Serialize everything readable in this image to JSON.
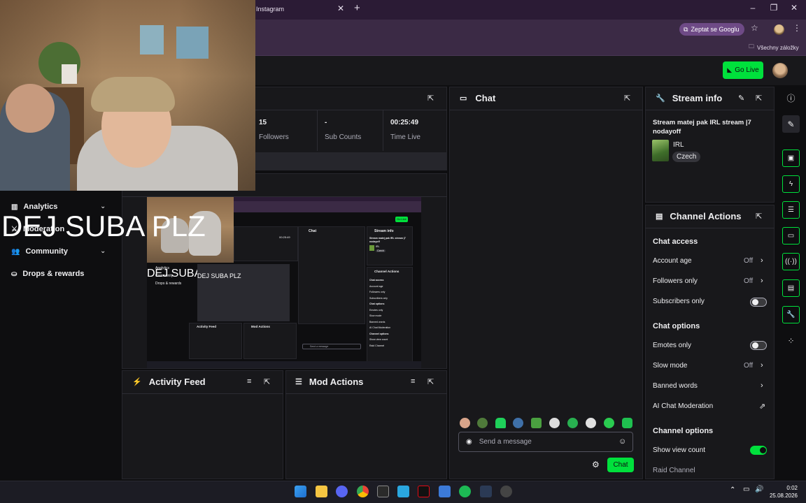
{
  "browser": {
    "tab_title": "Instagram",
    "tab_close": "✕",
    "tab_new": "+",
    "window_min": "–",
    "window_max": "❐",
    "window_close": "✕",
    "google_button": "Zeptat se Googlu",
    "bookmarks_label": "Všechny záložky"
  },
  "header": {
    "go_live": "Go Live"
  },
  "nav": {
    "items": [
      {
        "label": "Analytics",
        "icon": "bar-chart-icon",
        "expandable": true
      },
      {
        "label": "Moderation",
        "icon": "sword-icon",
        "expandable": false
      },
      {
        "label": "Community",
        "icon": "people-icon",
        "expandable": true
      },
      {
        "label": "Drops & rewards",
        "icon": "gift-icon",
        "expandable": false
      }
    ]
  },
  "stats": [
    {
      "value": "15",
      "label": "Followers"
    },
    {
      "value": "-",
      "label": "Sub Counts"
    },
    {
      "value": "00:25:49",
      "label": "Time Live"
    }
  ],
  "chat": {
    "title": "Chat",
    "placeholder": "Send a message",
    "button": "Chat"
  },
  "stream_info": {
    "title": "Stream info",
    "stream_title": "Stream matej pak IRL stream |7 nodayoff",
    "category": "IRL",
    "tag": "Czech"
  },
  "channel_actions": {
    "title": "Channel Actions",
    "sections": {
      "chat_access": "Chat access",
      "chat_options": "Chat options",
      "channel_options": "Channel options"
    },
    "rows": {
      "account_age": {
        "label": "Account age",
        "value": "Off"
      },
      "followers_only": {
        "label": "Followers only",
        "value": "Off"
      },
      "subscribers_only": {
        "label": "Subscribers only",
        "enabled": false
      },
      "emotes_only": {
        "label": "Emotes only",
        "enabled": false
      },
      "slow_mode": {
        "label": "Slow mode",
        "value": "Off"
      },
      "banned_words": {
        "label": "Banned words"
      },
      "ai_chat_moderation": {
        "label": "AI Chat Moderation"
      },
      "show_view_count": {
        "label": "Show view count",
        "enabled": true
      },
      "raid_channel": {
        "label": "Raid Channel"
      }
    }
  },
  "activity_feed": {
    "title": "Activity Feed"
  },
  "mod_actions": {
    "title": "Mod Actions"
  },
  "overlay": {
    "text": "DEJ SUBA PLZ"
  },
  "preview": {
    "overlay_text": "DEJ SUBA PLZ",
    "nested_overlay_text": "DEJ SUBA PLZ",
    "nav": [
      "Analytics",
      "Community",
      "Drops & rewards"
    ],
    "stream_info": "Stream info",
    "stream_title": "Stream matej pak IRL stream |7 nodayoff",
    "category": "IRL",
    "tag": "Czech",
    "time": "00:25:49",
    "channel_actions": "Channel Actions",
    "chat_access": "Chat access",
    "account_age": "Account age",
    "followers_only": "Followers only",
    "subscribers_only": "Subscribers only",
    "chat_options": "Chat options",
    "emotes_only": "Emotes only",
    "slow_mode": "Slow mode",
    "banned_words": "Banned words",
    "ai_chat_moderation": "AI Chat Moderation",
    "channel_options": "Channel options",
    "show_view_count": "Show view count",
    "raid_channel": "Raid Channel",
    "chat": "Chat",
    "activity_feed": "Activity Feed",
    "mod_actions": "Mod Actions",
    "send_placeholder": "Send a message",
    "go_live": "Go Live"
  },
  "taskbar": {
    "time": "0:02",
    "date": "25.08.2026"
  },
  "colors": {
    "accent": "#00e03c",
    "panel": "#18181b",
    "background": "#0e0e10",
    "browser_frame": "#3b2a45"
  }
}
